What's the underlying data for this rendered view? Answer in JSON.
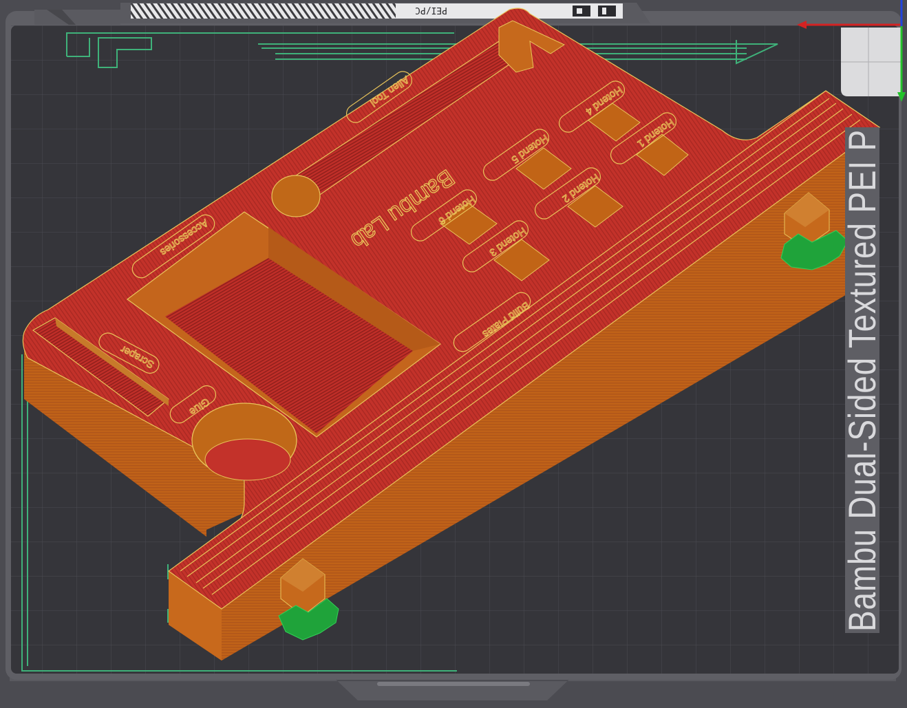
{
  "app": {
    "view": "slice preview",
    "view_mode": "isometric"
  },
  "build_plate": {
    "name_label": "Bambu Dual-Sided Textured PEI P",
    "pattern_text": "PEI/PC",
    "colors": {
      "plate": "#36363b",
      "grid": "#4a4a52",
      "frame": "#5c5c62",
      "bezel": "#606067",
      "label_bg": "#5e5e64",
      "label_text": "#d9d9dc"
    }
  },
  "model": {
    "colors": {
      "top_surface": "#c0302a",
      "side_wall": "#c4651a",
      "side_wall_dark": "#a85418",
      "outline": "#e9c45a",
      "support": "#1fa33a",
      "travel_lines": "#3fb27a"
    },
    "emboss_labels": {
      "scraper": "Scraper",
      "glue": "Glue",
      "accessories": "Accessories",
      "allen_tool": "Allen Tool",
      "build_plates": "Build Plates",
      "hotend_1": "Hotend 1",
      "hotend_2": "Hotend 2",
      "hotend_3": "Hotend 3",
      "hotend_4": "Hotend 4",
      "hotend_5": "Hotend 5",
      "hotend_6": "Hotend 6",
      "brand": "Bambu Lab"
    }
  },
  "axes": {
    "x_color": "#d42222",
    "y_color": "#22c22a",
    "z_color": "#2244dd"
  }
}
